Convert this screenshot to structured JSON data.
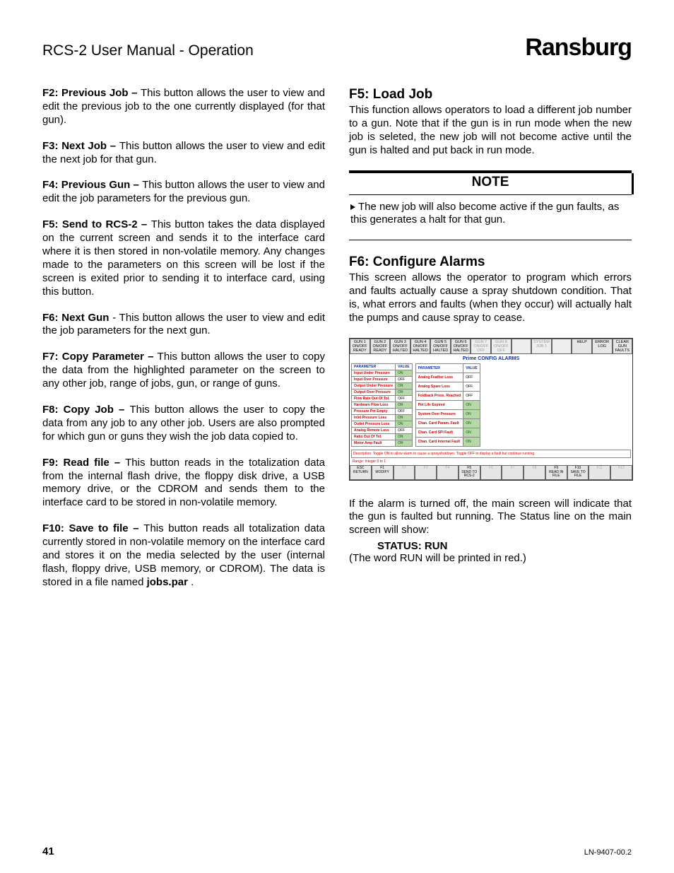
{
  "header": {
    "title": "RCS-2 User Manual  - Operation",
    "brand": "Ransburg"
  },
  "left": {
    "f2": {
      "label": "F2: Previous Job – ",
      "text": "This button allows the user to view and edit the previous job to the one currently displayed (for that gun)."
    },
    "f3": {
      "label": "F3: Next Job – ",
      "text": "This button allows the user to view and edit the next job for that gun."
    },
    "f4": {
      "label": "F4: Previous Gun – ",
      "text": "This button allows the user to view and edit the job parameters for the pre­vious gun."
    },
    "f5": {
      "label": "F5: Send to RCS-2 – ",
      "text": "This button takes the data displayed on the current screen and sends it to the interface card where it is then stored in non-volatile memory.  Any changes made to the parameters on this screen will be lost if the screen is exited prior to sending it to interface card, using this button."
    },
    "f6": {
      "label": "F6:  Next Gun ",
      "text": "- This button allows the user to view and edit the job parameters for the next gun."
    },
    "f7": {
      "label": "F7: Copy Parameter – ",
      "text": "This button allows the user to copy the data from the highlighted parameter on the screen to any other job, range of jobs, gun, or range of guns."
    },
    "f8": {
      "label": "F8: Copy Job – ",
      "text": "This button allows the user to copy the data from any job to any other job.  Users are also prompted for which gun or guns they wish the job data copied to."
    },
    "f9": {
      "label": "F9: Read file – ",
      "text": "This button reads in the totalization data from the internal flash drive, the floppy disk drive, a USB memory drive, or the CDROM and sends them to the interface card to be stored in non-volatile memory."
    },
    "f10": {
      "label": "F10: Save to file – ",
      "text_a": "This button reads all totaliza­tion data currently stored in non-volatile memory on the interface card and stores it on the media selected by the user (internal flash, floppy drive, USB memory, or CDROM).  The data is stored in a file named ",
      "file": "jobs.par",
      "text_b": " ."
    }
  },
  "right": {
    "f5": {
      "head": "F5:  Load Job",
      "text": "This function allows operators to load a different job number to a gun.  Note that if the gun is in run mode when the new job is seleted, the new job will not become active until the gun is halted and put back in run mode."
    },
    "note": {
      "title": "NOTE",
      "body": "The new job will also become active if the gun faults, as this generates a halt for that gun."
    },
    "f6": {
      "head": "F6:  Configure Alarms",
      "text": "This screen allows the operator to program which errors and faults actually cause a spray shutdown condition.  That is, what errors and faults (when they occur) will actually halt the pumps and cause spray to cease."
    },
    "after": {
      "p1": "If the alarm is turned off, the main screen will indicate that the gun is faulted but running.  The Status line on the main screen will show:",
      "status": "STATUS:  RUN",
      "p2": "(The word RUN will be printed in red.)"
    }
  },
  "screenshot": {
    "topButtons": [
      {
        "l1": "GUN 1",
        "l2": "ON/OFF",
        "l3": "READY"
      },
      {
        "l1": "GUN 2",
        "l2": "ON/OFF",
        "l3": "READY"
      },
      {
        "l1": "GUN 3",
        "l2": "ON/OFF",
        "l3": "HALTED"
      },
      {
        "l1": "GUN 4",
        "l2": "ON/OFF",
        "l3": "HALTED"
      },
      {
        "l1": "GUN 5",
        "l2": "ON/OFF",
        "l3": "HALTED"
      },
      {
        "l1": "GUN 6",
        "l2": "ON/OFF",
        "l3": "HALTED"
      },
      {
        "l1": "GUN 7",
        "l2": "ON/OFF",
        "l3": "OFF",
        "dim": true
      },
      {
        "l1": "GUN 8",
        "l2": "ON/OFF",
        "l3": "OFF",
        "dim": true
      },
      {
        "l1": "",
        "l2": "",
        "l3": "",
        "dim": true
      },
      {
        "l1": "SYSTEM",
        "l2": "JOB 1",
        "l3": "",
        "dim": true
      },
      {
        "l1": "",
        "l2": "",
        "l3": "",
        "dim": true
      },
      {
        "l1": "HELP",
        "l2": "",
        "l3": ""
      },
      {
        "l1": "ERROR",
        "l2": "LOG",
        "l3": ""
      },
      {
        "l1": "CLEAR",
        "l2": "GUN",
        "l3": "FAULTS"
      }
    ],
    "title": "Prime CONFIG ALARMS",
    "headers": {
      "param": "PARAMETER",
      "value": "VALUE"
    },
    "alarmsLeft": [
      {
        "p": "Input Under Pressure",
        "v": "ON",
        "on": true
      },
      {
        "p": "Input Over Pressure",
        "v": "OFF",
        "on": false
      },
      {
        "p": "Output Under Pressure",
        "v": "ON",
        "on": true
      },
      {
        "p": "Output Over Pressure",
        "v": "ON",
        "on": true
      },
      {
        "p": "Flow Rate Out Of Tol.",
        "v": "OFF",
        "on": false
      },
      {
        "p": "Hardware Flow Loss",
        "v": "ON",
        "on": true
      },
      {
        "p": "Pressure Pot Empty",
        "v": "OFF",
        "on": false
      },
      {
        "p": "Inlet Pressure Loss",
        "v": "ON",
        "on": true
      },
      {
        "p": "Outlet Pressure Loss",
        "v": "ON",
        "on": true
      },
      {
        "p": "Analog Remote Loss",
        "v": "OFF",
        "on": false
      },
      {
        "p": "Ratio Out Of Tol.",
        "v": "ON",
        "on": true
      },
      {
        "p": "Motor Amp Fault",
        "v": "ON",
        "on": true
      }
    ],
    "alarmsRight": [
      {
        "p": "Analog Feather Loss",
        "v": "OFF",
        "on": false
      },
      {
        "p": "Analog Spare Loss",
        "v": "OFF",
        "on": false
      },
      {
        "p": "Foldback Press. Reached",
        "v": "OFF",
        "on": false
      },
      {
        "p": "Pot Life Expired",
        "v": "ON",
        "on": true
      },
      {
        "p": "System Over Pressure",
        "v": "ON",
        "on": true
      },
      {
        "p": "Chan. Card Param. Fault",
        "v": "ON",
        "on": true
      },
      {
        "p": "Chan. Card SPI Fault",
        "v": "ON",
        "on": true
      },
      {
        "p": "Chan. Card Internal Fault",
        "v": "ON",
        "on": true
      }
    ],
    "description": "Description: Toggle ON to allow alarm to cause a sprayshutdown. Toggle OFF to display a fault but continue running.",
    "range": "Range: Integer 0 to 1",
    "botButtons": [
      {
        "l1": "ESC",
        "l2": "RETURN"
      },
      {
        "l1": "F1",
        "l2": "MODIFY"
      },
      {
        "l1": "F2",
        "l2": "",
        "dim": true
      },
      {
        "l1": "F3",
        "l2": "",
        "dim": true
      },
      {
        "l1": "F4",
        "l2": "",
        "dim": true
      },
      {
        "l1": "F5",
        "l2": "SEND TO",
        "l3": "RCS-2"
      },
      {
        "l1": "F6",
        "l2": "",
        "dim": true
      },
      {
        "l1": "F7",
        "l2": "",
        "dim": true
      },
      {
        "l1": "F8",
        "l2": "",
        "dim": true
      },
      {
        "l1": "F9",
        "l2": "READ IN",
        "l3": "FILE"
      },
      {
        "l1": "F10",
        "l2": "SAVE TO",
        "l3": "FILE"
      },
      {
        "l1": "F11",
        "l2": "",
        "dim": true
      },
      {
        "l1": "F12",
        "l2": "",
        "dim": true
      }
    ]
  },
  "footer": {
    "page": "41",
    "code": "LN-9407-00.2"
  }
}
